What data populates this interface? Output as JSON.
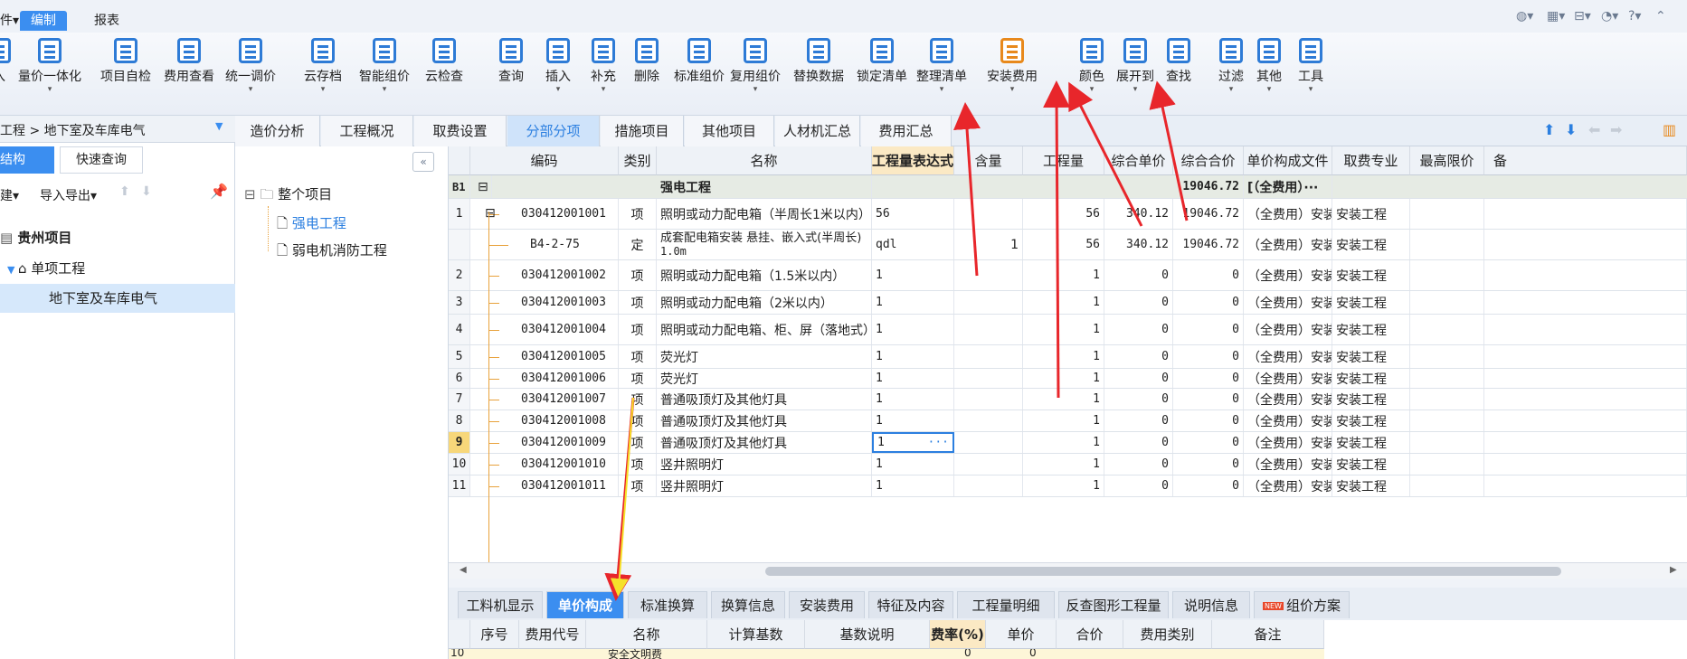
{
  "menubar": {
    "file_fragment": "件",
    "edit": "编制",
    "report": "报表"
  },
  "ribbon": {
    "buttons": [
      {
        "label": "入",
        "icon": "import-icon",
        "color": "#2e7bd6"
      },
      {
        "label": "量价一体化",
        "icon": "integrate-icon",
        "color": "#2e7bd6"
      },
      {
        "label": "项目自检",
        "icon": "project-check-icon",
        "color": "#2e7bd6"
      },
      {
        "label": "费用查看",
        "icon": "fee-view-icon",
        "color": "#2e7bd6"
      },
      {
        "label": "统一调价",
        "icon": "price-adjust-icon",
        "color": "#2e7bd6"
      },
      {
        "label": "云存档",
        "icon": "cloud-save-icon",
        "color": "#2e7bd6"
      },
      {
        "label": "智能组价",
        "icon": "smart-price-icon",
        "color": "#2e7bd6"
      },
      {
        "label": "云检查",
        "icon": "cloud-check-icon",
        "color": "#2e7bd6"
      },
      {
        "label": "查询",
        "icon": "query-icon",
        "color": "#2e7bd6"
      },
      {
        "label": "插入",
        "icon": "insert-icon",
        "color": "#2e7bd6"
      },
      {
        "label": "补充",
        "icon": "supplement-icon",
        "color": "#2e7bd6"
      },
      {
        "label": "删除",
        "icon": "delete-icon",
        "color": "#2e7bd6"
      },
      {
        "label": "标准组价",
        "icon": "standard-price-icon",
        "color": "#2e7bd6"
      },
      {
        "label": "复用组价",
        "icon": "reuse-price-icon",
        "color": "#2e7bd6"
      },
      {
        "label": "替换数据",
        "icon": "replace-data-icon",
        "color": "#2e7bd6"
      },
      {
        "label": "锁定清单",
        "icon": "lock-list-icon",
        "color": "#2e7bd6"
      },
      {
        "label": "整理清单",
        "icon": "organize-list-icon",
        "color": "#2e7bd6"
      },
      {
        "label": "安装费用",
        "icon": "install-fee-icon",
        "color": "#e8891c"
      },
      {
        "label": "颜色",
        "icon": "color-icon",
        "color": "#2e7bd6"
      },
      {
        "label": "展开到",
        "icon": "expand-to-icon",
        "color": "#2e7bd6"
      },
      {
        "label": "查找",
        "icon": "find-icon",
        "color": "#2e7bd6"
      },
      {
        "label": "过滤",
        "icon": "filter-icon",
        "color": "#2e7bd6"
      },
      {
        "label": "其他",
        "icon": "other-icon",
        "color": "#2e7bd6"
      },
      {
        "label": "工具",
        "icon": "tools-icon",
        "color": "#2e7bd6"
      }
    ]
  },
  "left": {
    "breadcrumb": "工程 > 地下室及车库电气",
    "tab_structure": "结构",
    "tab_quick": "快速查询",
    "build": "建",
    "import_export": "导入导出",
    "tree": {
      "root": "贵州项目",
      "single": "单项工程",
      "selected": "地下室及车库电气"
    }
  },
  "middle": {
    "root": "整个项目",
    "items": [
      "强电工程",
      "弱电机消防工程"
    ]
  },
  "tabs": [
    "造价分析",
    "工程概况",
    "取费设置",
    "分部分项",
    "措施项目",
    "其他项目",
    "人材机汇总",
    "费用汇总"
  ],
  "grid": {
    "headers": [
      "编码",
      "类别",
      "名称",
      "工程量表达式",
      "含量",
      "工程量",
      "综合单价",
      "综合合价",
      "单价构成文件",
      "取费专业",
      "最高限价",
      "备"
    ],
    "group_row": {
      "idx": "B1",
      "name": "强电工程",
      "total": "19046.72",
      "file": "[（全费用）···"
    },
    "rows": [
      {
        "idx": "1",
        "code": "030412001001",
        "type": "项",
        "name": "照明或动力配电箱（半周长1米以内）",
        "expr": "56",
        "content": "",
        "qty": "56",
        "price": "340.12",
        "total": "19046.72",
        "file": "（全费用）安装",
        "major": "安装工程"
      },
      {
        "idx": "",
        "code": "B4-2-75",
        "type": "定",
        "name": "成套配电箱安装 悬挂、嵌入式(半周长)",
        "name2": "1.0m",
        "expr": "qdl",
        "content": "1",
        "qty": "56",
        "price": "340.12",
        "total": "19046.72",
        "file": "（全费用）安装",
        "major": "安装工程"
      },
      {
        "idx": "2",
        "code": "030412001002",
        "type": "项",
        "name": "照明或动力配电箱（1.5米以内）",
        "expr": "1",
        "content": "",
        "qty": "1",
        "price": "0",
        "total": "0",
        "file": "（全费用）安装",
        "major": "安装工程"
      },
      {
        "idx": "3",
        "code": "030412001003",
        "type": "项",
        "name": "照明或动力配电箱（2米以内）",
        "expr": "1",
        "content": "",
        "qty": "1",
        "price": "0",
        "total": "0",
        "file": "（全费用）安装",
        "major": "安装工程"
      },
      {
        "idx": "4",
        "code": "030412001004",
        "type": "项",
        "name": "照明或动力配电箱、柜、屏（落地式）",
        "expr": "1",
        "content": "",
        "qty": "1",
        "price": "0",
        "total": "0",
        "file": "（全费用）安装",
        "major": "安装工程"
      },
      {
        "idx": "5",
        "code": "030412001005",
        "type": "项",
        "name": "荧光灯",
        "expr": "1",
        "content": "",
        "qty": "1",
        "price": "0",
        "total": "0",
        "file": "（全费用）安装",
        "major": "安装工程"
      },
      {
        "idx": "6",
        "code": "030412001006",
        "type": "项",
        "name": "荧光灯",
        "expr": "1",
        "content": "",
        "qty": "1",
        "price": "0",
        "total": "0",
        "file": "（全费用）安装",
        "major": "安装工程"
      },
      {
        "idx": "7",
        "code": "030412001007",
        "type": "项",
        "name": "普通吸顶灯及其他灯具",
        "expr": "1",
        "content": "",
        "qty": "1",
        "price": "0",
        "total": "0",
        "file": "（全费用）安装",
        "major": "安装工程"
      },
      {
        "idx": "8",
        "code": "030412001008",
        "type": "项",
        "name": "普通吸顶灯及其他灯具",
        "expr": "1",
        "content": "",
        "qty": "1",
        "price": "0",
        "total": "0",
        "file": "（全费用）安装",
        "major": "安装工程"
      },
      {
        "idx": "9",
        "code": "030412001009",
        "type": "项",
        "name": "普通吸顶灯及其他灯具",
        "expr": "1",
        "content": "",
        "qty": "1",
        "price": "0",
        "total": "0",
        "file": "（全费用）安装",
        "major": "安装工程",
        "selected": true
      },
      {
        "idx": "10",
        "code": "030412001010",
        "type": "项",
        "name": "竖井照明灯",
        "expr": "1",
        "content": "",
        "qty": "1",
        "price": "0",
        "total": "0",
        "file": "（全费用）安装",
        "major": "安装工程"
      },
      {
        "idx": "11",
        "code": "030412001011",
        "type": "项",
        "name": "竖井照明灯",
        "expr": "1",
        "content": "",
        "qty": "1",
        "price": "0",
        "total": "0",
        "file": "（全费用）安装",
        "major": "安装工程"
      }
    ]
  },
  "bottom_tabs": [
    "工料机显示",
    "单价构成",
    "标准换算",
    "换算信息",
    "安装费用",
    "特征及内容",
    "工程量明细",
    "反查图形工程量",
    "说明信息",
    "组价方案"
  ],
  "bottom_new_badge": "NEW",
  "bottom_grid": {
    "headers": [
      "序号",
      "费用代号",
      "名称",
      "计算基数",
      "基数说明",
      "费率(%)",
      "单价",
      "合价",
      "费用类别",
      "备注"
    ],
    "partial_row_idx": "10",
    "partial_row_name": "安全文明费",
    "partial_price": "0",
    "partial_total": "0"
  },
  "colors": {
    "accent": "#3b8ef0",
    "annotation_red": "#e8262b",
    "annotation_yellow": "#f5e12a"
  }
}
